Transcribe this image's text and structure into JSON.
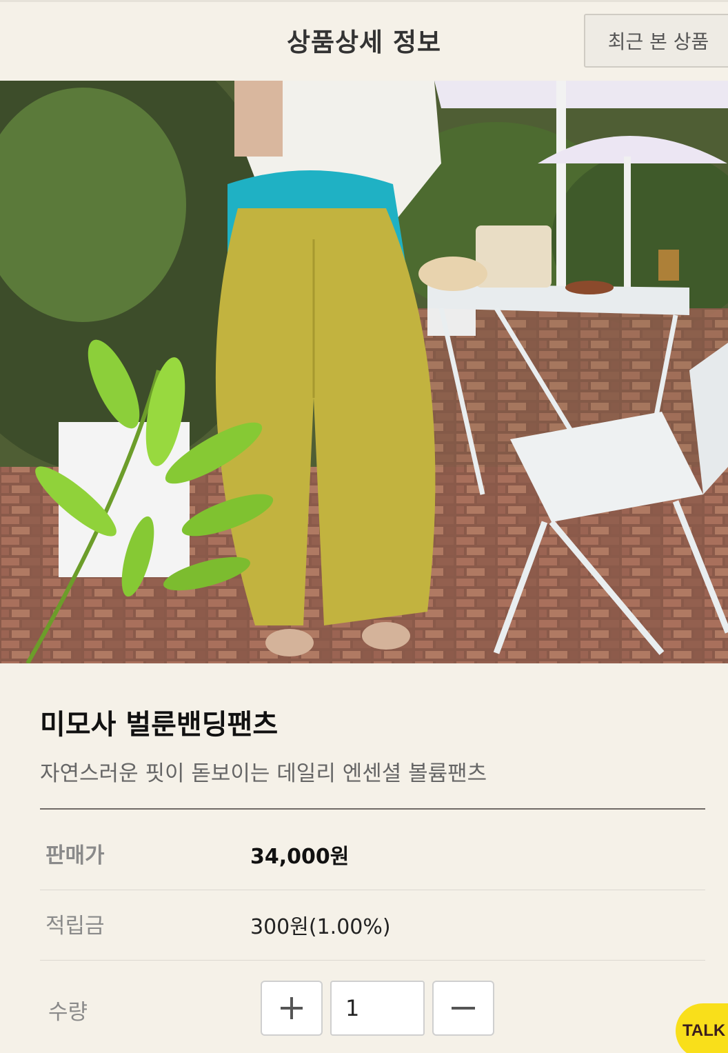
{
  "header": {
    "title": "상품상세 정보",
    "recent_label": "최근 본 상품"
  },
  "product": {
    "name": "미모사 벌룬밴딩팬츠",
    "description": "자연스러운 핏이 돋보이는 데일리 엔센셜 볼륨팬츠"
  },
  "info": {
    "price_label": "판매가",
    "price_value": "34,000원",
    "points_label": "적립금",
    "points_value": "300원(1.00%)",
    "qty_label": "수량",
    "qty_value": "1"
  },
  "floating": {
    "talk_label": "TALK"
  },
  "colors": {
    "background": "#f5f1e8",
    "talk_button": "#f9df1a",
    "pants": "#c2b33f",
    "cardigan": "#1fb1c4"
  },
  "icons": {
    "plus": "plus-icon",
    "minus": "minus-icon"
  }
}
